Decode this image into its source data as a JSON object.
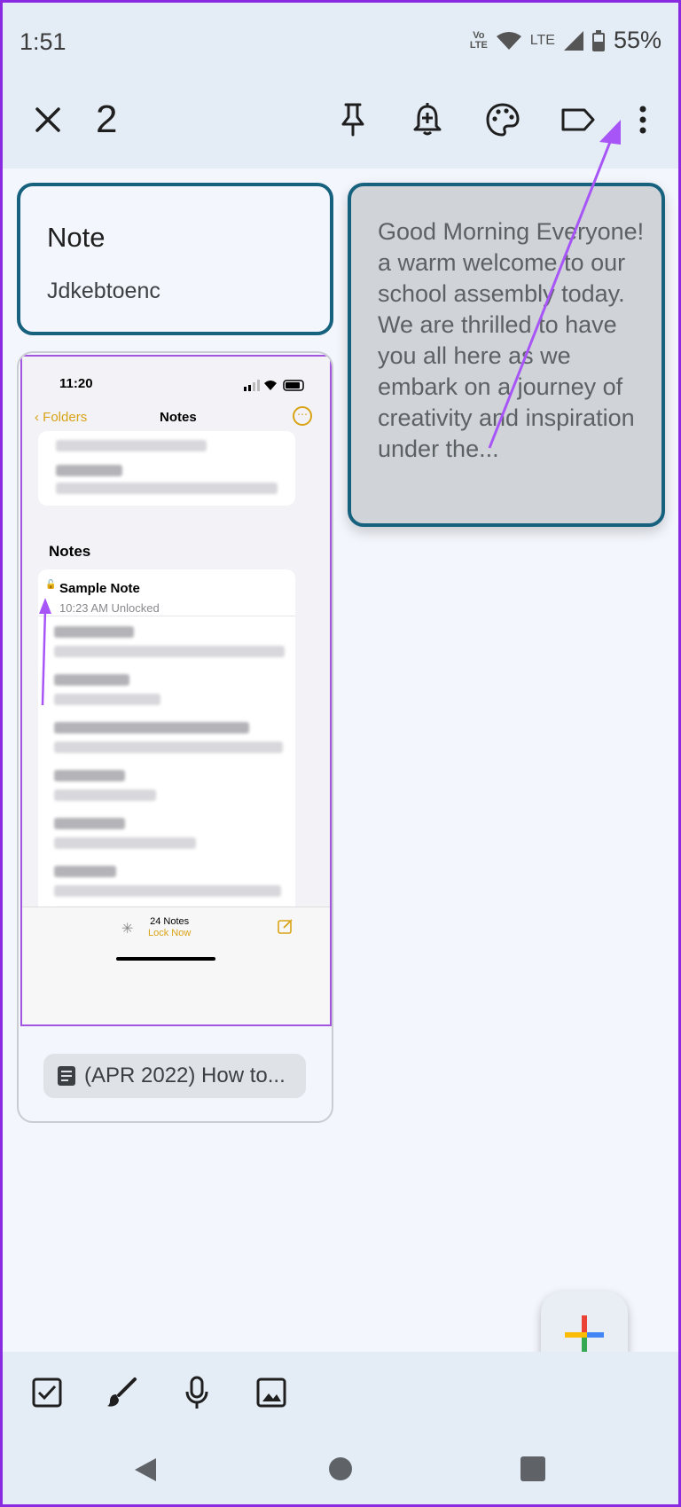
{
  "status_bar": {
    "time": "1:51",
    "volte_top": "Vo",
    "volte_bottom": "LTE",
    "lte": "LTE",
    "battery": "55%"
  },
  "action_bar": {
    "selected_count": "2",
    "icons": [
      "close-icon",
      "pin-icon",
      "reminder-bell-icon",
      "palette-icon",
      "label-icon",
      "more-vert-icon"
    ]
  },
  "cards": {
    "note": {
      "title": "Note",
      "body": "Jdkebtoenc"
    },
    "morning": {
      "text": "Good Morning Everyone! a warm welcome to our school assembly today. We are thrilled to have you all here as we embark on a journey of creativity and inspiration under the..."
    },
    "image_card": {
      "screenshot": {
        "time": "11:20",
        "back_label": "Folders",
        "title": "Notes",
        "more_glyph": "⋯",
        "section": "Notes",
        "sample_title": "Sample Note",
        "sample_meta": "10:23 AM   Unlocked",
        "notes_count": "24 Notes",
        "lock_now": "Lock Now"
      },
      "link_label": "(APR 2022) How to..."
    }
  },
  "bottom_bar": {
    "icons": [
      "checkbox-icon",
      "brush-icon",
      "mic-icon",
      "image-icon"
    ]
  },
  "colors": {
    "accent_border": "#16617e",
    "highlight_arrow": "#a855f7",
    "ios_yellow": "#d9a316"
  }
}
